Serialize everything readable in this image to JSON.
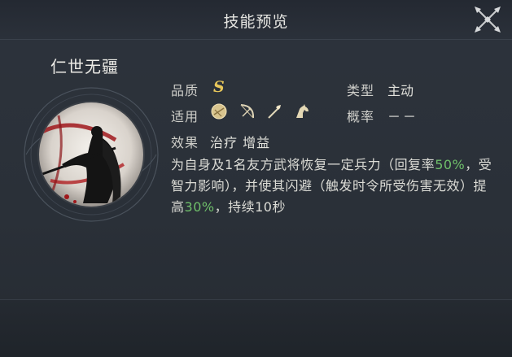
{
  "header": {
    "title": "技能预览"
  },
  "skill": {
    "name": "仁世无疆",
    "grade_label": "品质",
    "grade_value": "S",
    "type_label": "类型",
    "type_value": "主动",
    "applicable_label": "适用",
    "applicable_icons": [
      "shield-icon",
      "bow-icon",
      "spear-icon",
      "horse-icon"
    ],
    "probability_label": "概率",
    "probability_value": "－－",
    "effect_label": "效果",
    "effect_tags": "治疗 增益",
    "desc": {
      "part1": "为自身及1名友方武将恢复一定兵力（回复率",
      "pct1": "50%",
      "part2": "，受智力影响），并使其闪避（触发时令所受伤害无效）提高",
      "pct2": "30%",
      "part3": "，持续10秒"
    }
  },
  "colors": {
    "accent_green": "#6fbf6a",
    "grade_gold": "#e8c75a",
    "panel_bg": "#2a3038"
  }
}
